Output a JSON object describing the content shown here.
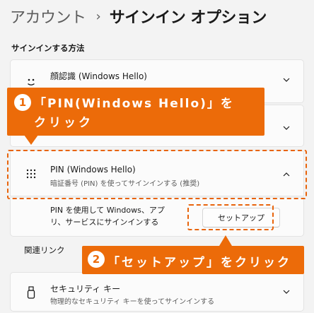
{
  "breadcrumb": {
    "parent": "アカウント",
    "separator": "›",
    "current": "サインイン オプション"
  },
  "section_title": "サインインする方法",
  "face": {
    "title": "顔認識 (Windows Hello)",
    "icon": "face-icon"
  },
  "fingerprint": {
    "icon": "fingerprint-icon"
  },
  "pin": {
    "title": "PIN (Windows Hello)",
    "description": "暗証番号 (PIN) を使ってサインインする (推奨)",
    "body_line1": "PIN を使用して Windows、アプ",
    "body_line2": "リ、サービスにサインインする",
    "setup_button": "セットアップ",
    "icon": "keypad-icon"
  },
  "related_links_label": "関連リンク",
  "security_key": {
    "title": "セキュリティ キー",
    "description": "物理的なセキュリティ キーを使ってサインインする",
    "icon": "usb-key-icon"
  },
  "callout1": {
    "number": "1",
    "line1": "「PIN(Windows Hello)」を",
    "line2": "クリック"
  },
  "callout2": {
    "number": "2",
    "text": "「セットアップ」をクリック"
  },
  "colors": {
    "accent_orange": "#ec6b09",
    "background": "#f3f3f3",
    "card": "#fbfbfb"
  }
}
